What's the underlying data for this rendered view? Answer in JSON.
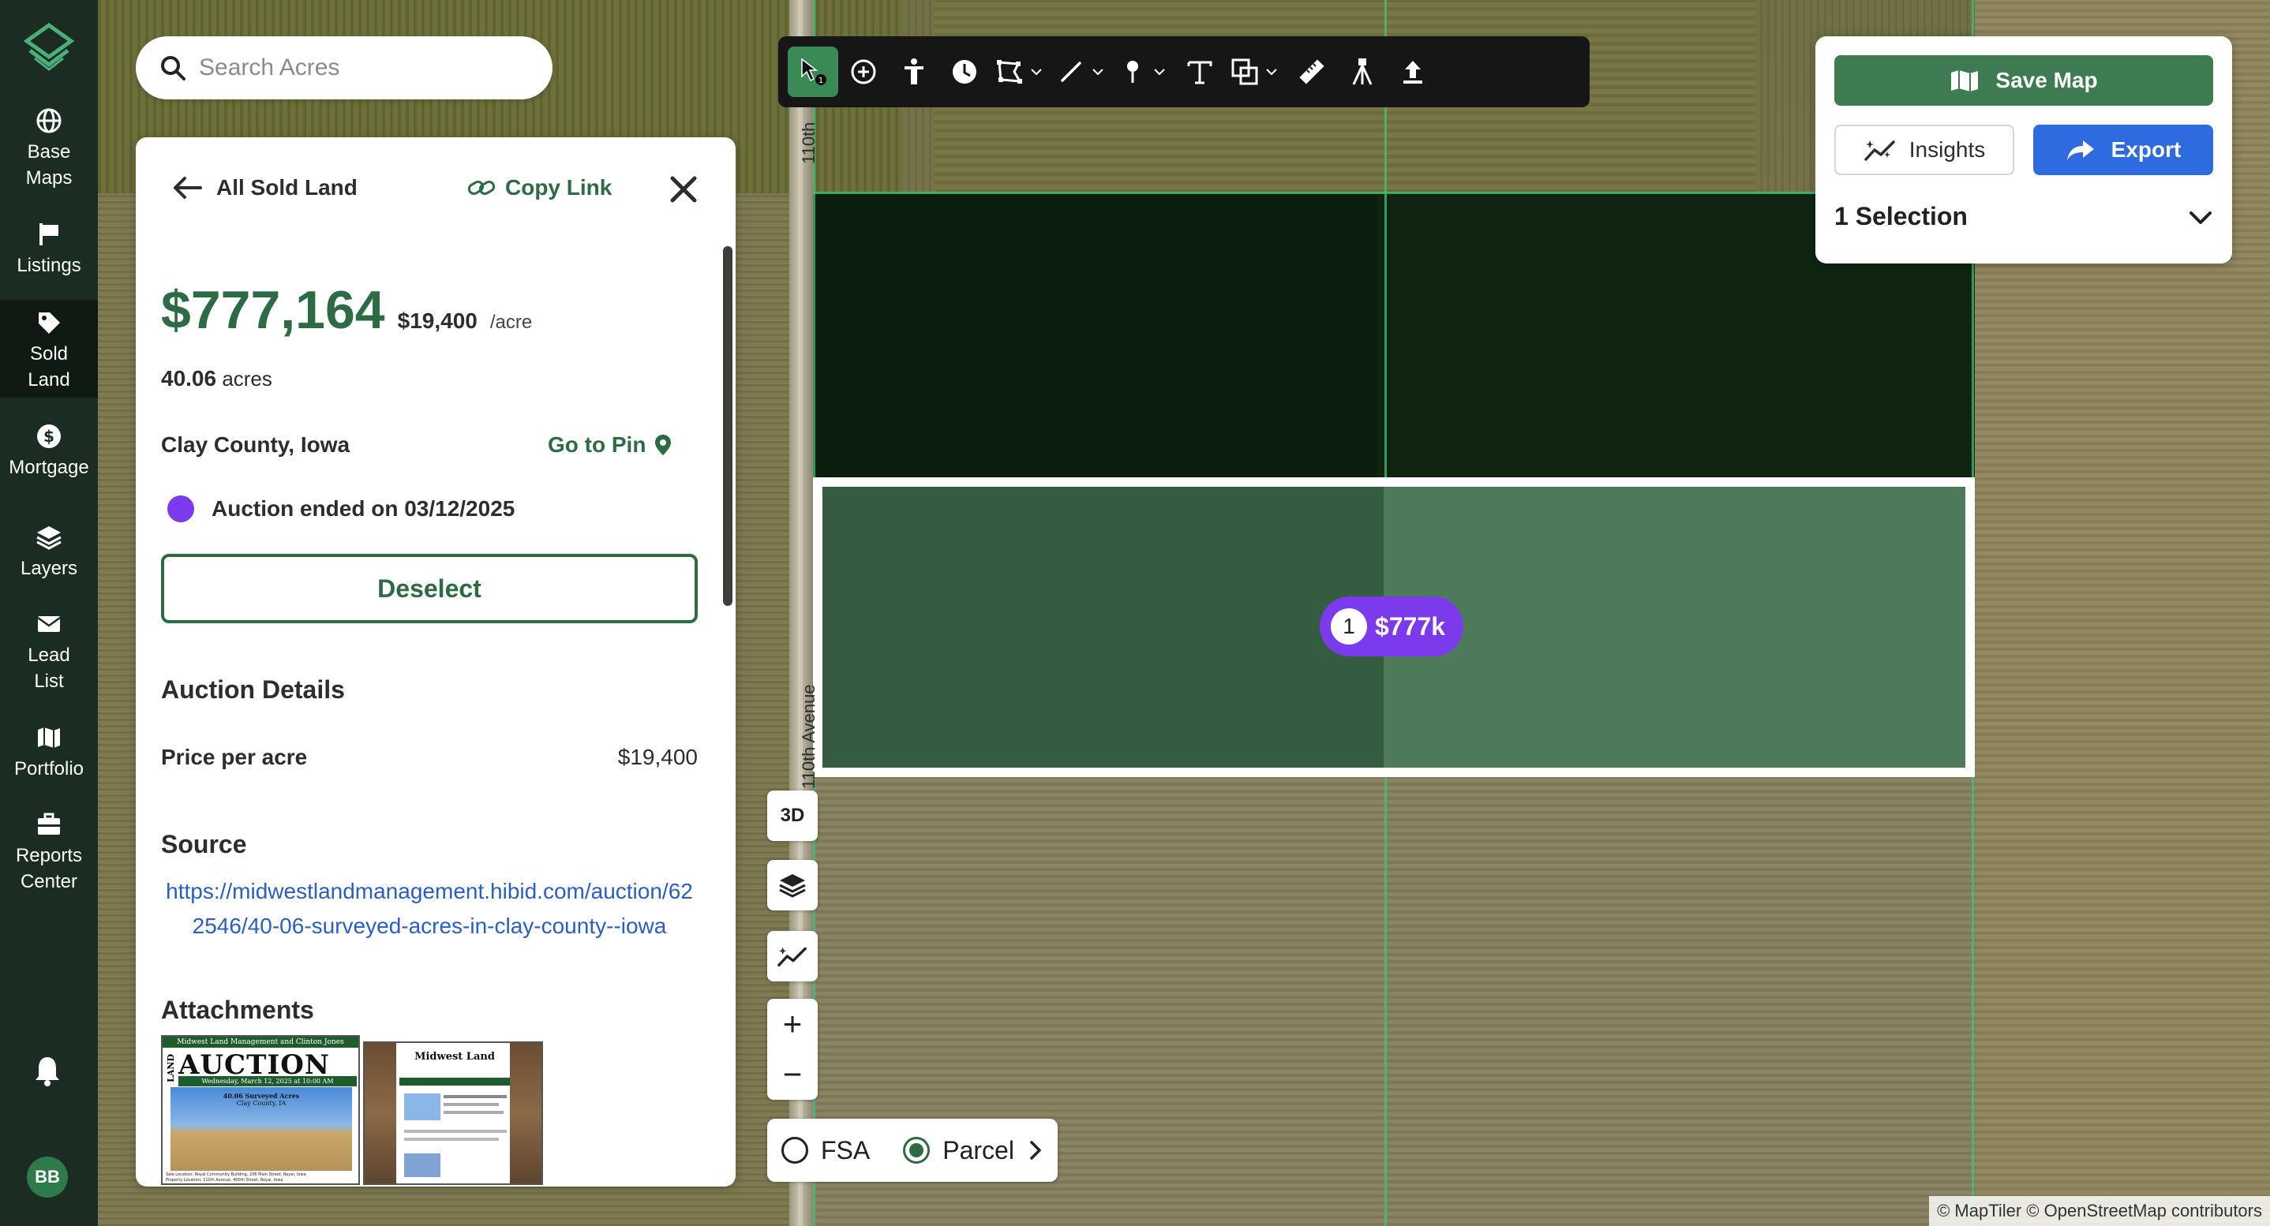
{
  "nav": {
    "items": [
      {
        "label_1": "Base",
        "label_2": "Maps",
        "icon": "globe-icon"
      },
      {
        "label_1": "Listings",
        "label_2": "",
        "icon": "flag-icon"
      },
      {
        "label_1": "Sold",
        "label_2": "Land",
        "icon": "tag-icon"
      },
      {
        "label_1": "Mortgage",
        "label_2": "",
        "icon": "dollar-icon"
      },
      {
        "label_1": "Layers",
        "label_2": "",
        "icon": "layers-icon"
      },
      {
        "label_1": "Lead",
        "label_2": "List",
        "icon": "mail-icon"
      },
      {
        "label_1": "Portfolio",
        "label_2": "",
        "icon": "map-icon"
      },
      {
        "label_1": "Reports",
        "label_2": "Center",
        "icon": "briefcase-icon"
      }
    ],
    "active": "Sold Land",
    "avatar_initials": "BB"
  },
  "search": {
    "placeholder": "Search Acres"
  },
  "panel": {
    "back_label": "All Sold Land",
    "copy_link_label": "Copy Link",
    "price": "$777,164",
    "price_per_acre": "$19,400",
    "per_acre_unit": "/acre",
    "acres_value": "40.06",
    "acres_unit": "acres",
    "county": "Clay County, Iowa",
    "go_to_pin": "Go to Pin",
    "auction_status": "Auction ended on 03/12/2025",
    "deselect_label": "Deselect",
    "auction_details_title": "Auction Details",
    "price_per_acre_label": "Price per acre",
    "price_per_acre_value": "$19,400",
    "source_title": "Source",
    "source_url": "https://midwestlandmanagement.hibid.com/auction/622546/40-06-surveyed-acres-in-clay-county--iowa",
    "attachments_title": "Attachments",
    "attachment1": {
      "header": "Midwest Land Management and Clinton Jones",
      "side": "LAND",
      "title": "AUCTION",
      "date": "Wednesday, March 12, 2025 at 10:00 AM",
      "line1": "40.06 Surveyed Acres",
      "line2": "Clay County, IA",
      "footer1": "Sale Location: Royal Community Building, 206 Main Street, Royal, Iowa",
      "footer2": "Property Location: 110th Avenue, 400th Street, Royal, Iowa"
    },
    "attachment2": {
      "title": "Midwest Land"
    }
  },
  "map": {
    "road_label_top": "110th",
    "road_label_mid": "110th Avenue",
    "pin_count": "1",
    "pin_price": "$777k",
    "attribution": "© MapTiler © OpenStreetMap contributors",
    "btn_3d": "3D",
    "zoom_in": "+",
    "zoom_out": "−",
    "toggle_fsa": "FSA",
    "toggle_parcel": "Parcel"
  },
  "card": {
    "save_map_label": "Save Map",
    "insights_label": "Insights",
    "export_label": "Export",
    "selection_label": "1 Selection"
  },
  "colors": {
    "brand_green": "#2d6b45",
    "nav_bg": "#1b2d22",
    "auction_purple": "#7c3aed",
    "export_blue": "#2f6be0"
  }
}
